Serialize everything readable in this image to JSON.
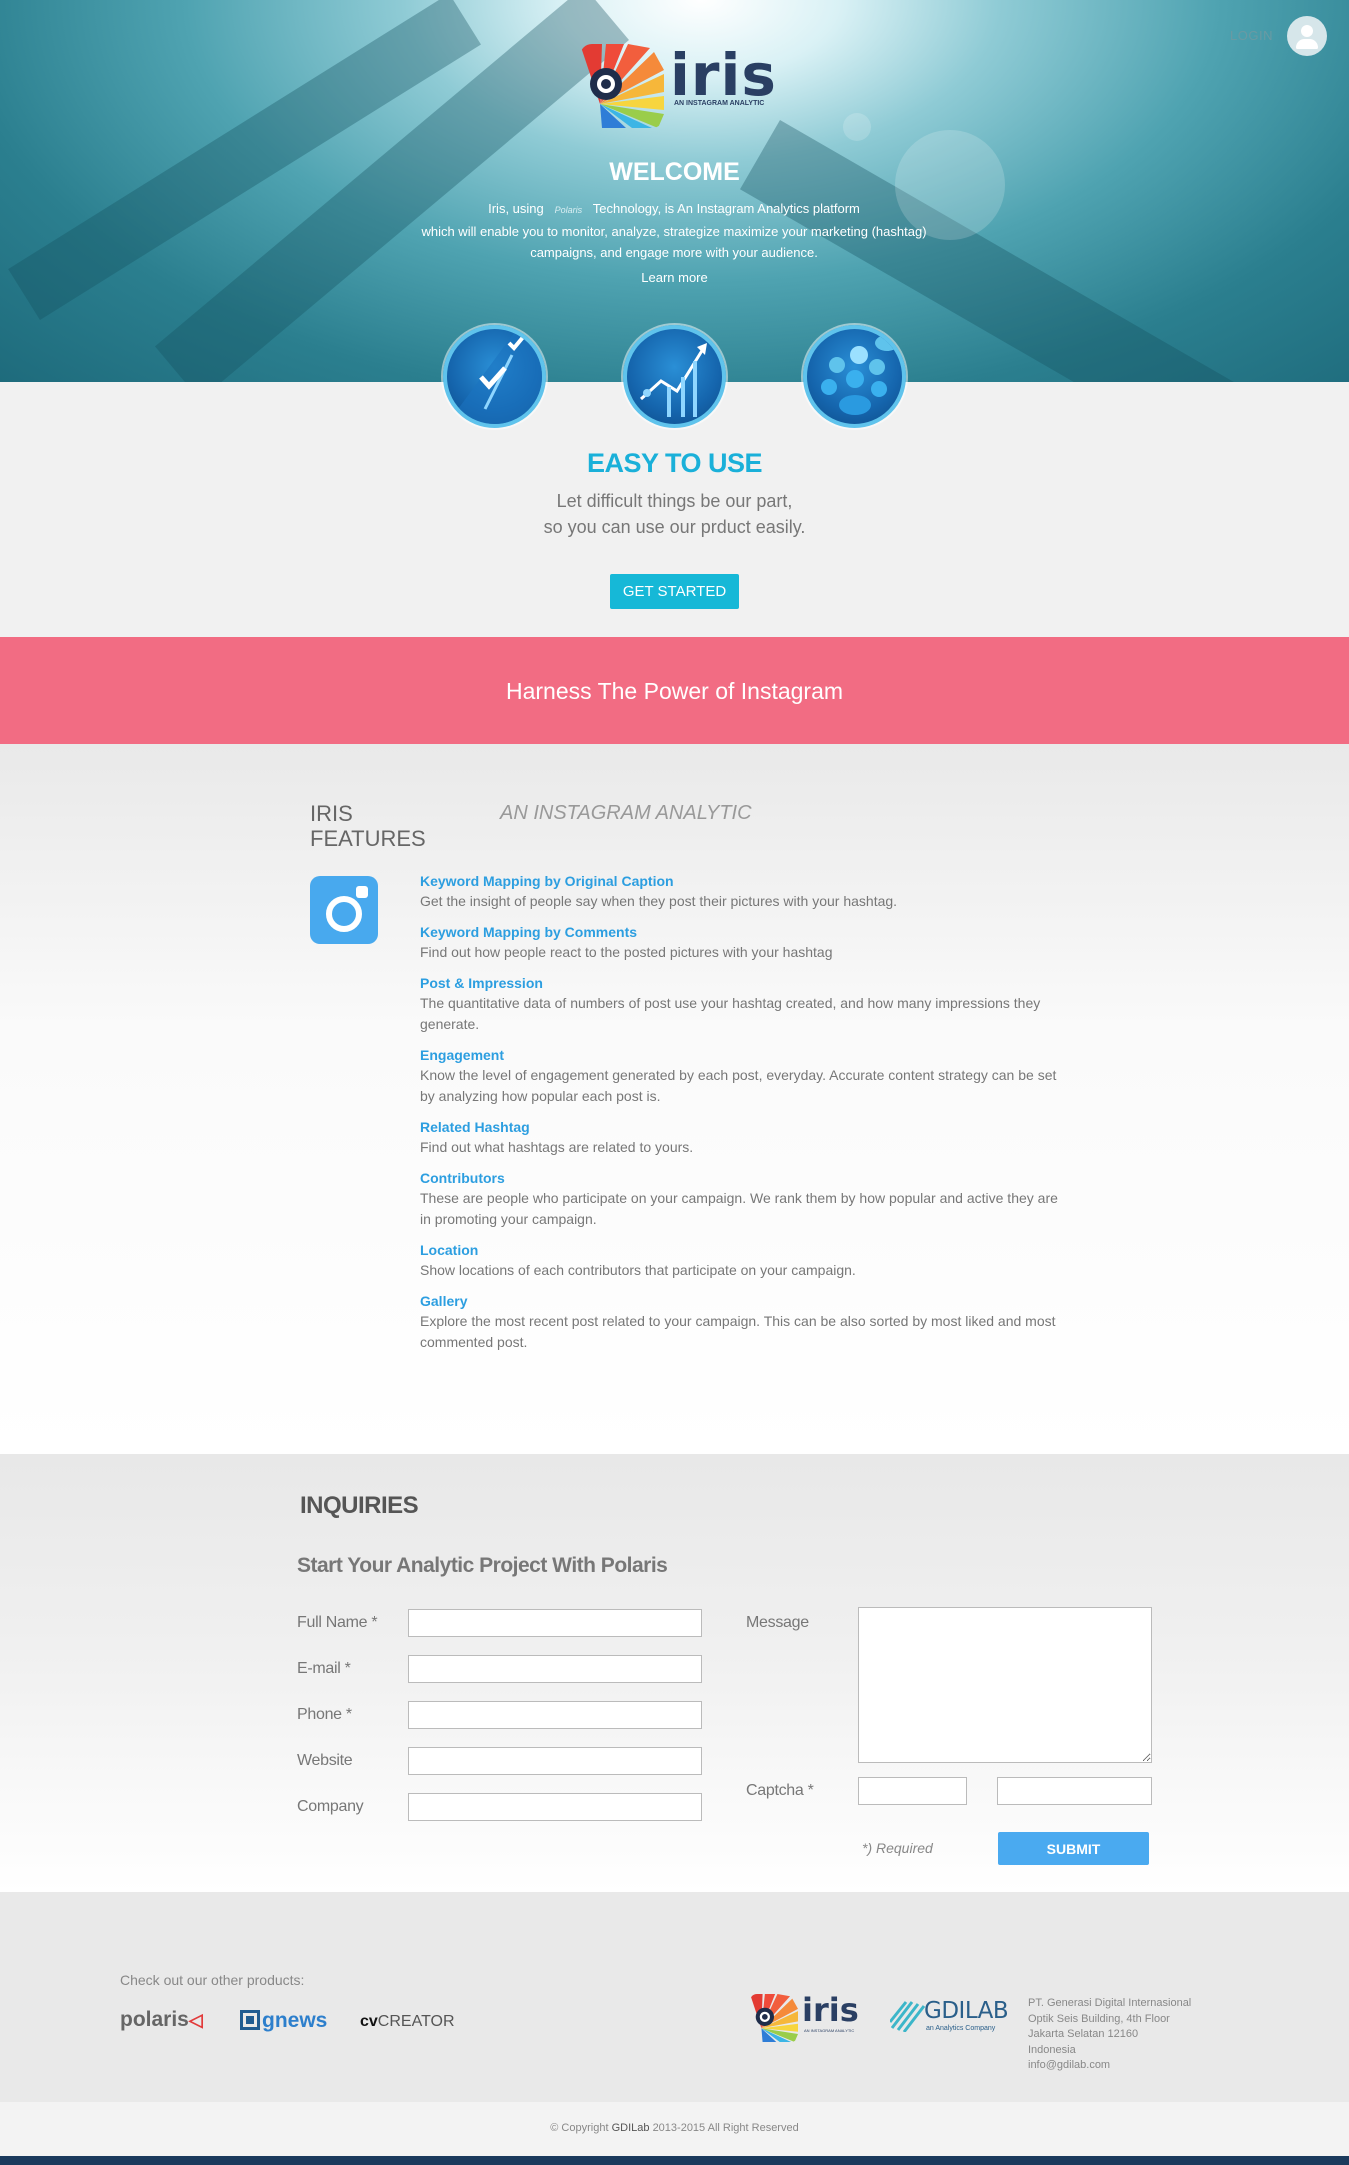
{
  "header": {
    "login_label": "LOGIN",
    "brand_name": "iris",
    "brand_dot": "",
    "brand_tagline": "AN INSTAGRAM ANALYTIC"
  },
  "hero": {
    "welcome": "WELCOME",
    "intro_before": "Iris, using",
    "intro_brand": "Polaris",
    "intro_after": "Technology, is An Instagram Analytics platform",
    "intro_line2": "which will enable you to monitor, analyze, strategize maximize your marketing (hashtag)",
    "intro_line3": "campaigns, and engage more with your audience.",
    "learn_more": "Learn more",
    "icons": [
      "checkmark-icon",
      "growth-chart-icon",
      "community-icon"
    ]
  },
  "easy": {
    "title": "EASY TO USE",
    "line1": "Let difficult things be our part,",
    "line2": "so you can use our prduct easily.",
    "cta": "GET STARTED"
  },
  "banner": {
    "title": "Harness The Power of Instagram"
  },
  "features": {
    "title_line1": "IRIS",
    "title_line2": "FEATURES",
    "tagline": "AN INSTAGRAM ANALYTIC",
    "items": [
      {
        "title": "Keyword Mapping by Original Caption",
        "desc": "Get the insight of people say when they post their pictures with your hashtag."
      },
      {
        "title": "Keyword Mapping by Comments",
        "desc": "Find out how people react to the posted pictures with your hashtag"
      },
      {
        "title": "Post & Impression",
        "desc": "The quantitative data of numbers of post use your hashtag created, and how many impressions they generate."
      },
      {
        "title": "Engagement",
        "desc": "Know the level of engagement generated by each post, everyday. Accurate content strategy can be set by analyzing how popular each post is."
      },
      {
        "title": "Related Hashtag",
        "desc": "Find out what hashtags are related to yours."
      },
      {
        "title": "Contributors",
        "desc": "These are people who participate on your campaign. We rank them by how popular and active they are in promoting your campaign."
      },
      {
        "title": "Location",
        "desc": "Show locations of each contributors that participate on your campaign."
      },
      {
        "title": "Gallery",
        "desc": "Explore the most recent post related to your campaign. This can be also sorted by most liked and most commented post."
      }
    ]
  },
  "inquiries": {
    "title": "INQUIRIES",
    "subtitle": "Start Your Analytic Project With Polaris",
    "full_name_label": "Full Name *",
    "email_label": "E-mail *",
    "phone_label": "Phone *",
    "website_label": "Website",
    "company_label": "Company",
    "message_label": "Message",
    "captcha_label": "Captcha *",
    "required_note": "*) Required",
    "submit_label": "SUBMIT"
  },
  "footer": {
    "other_products": "Check out our other products:",
    "product_polaris": "polaris",
    "product_gnews": "gnews",
    "product_cv_bold": "cv",
    "product_cv_rest": "CREATOR",
    "gdilab_name": "GDILAB",
    "gdilab_tagline": "an Analytics Company",
    "iris_name": "iris",
    "iris_tagline": "AN INSTAGRAM ANALYTIC",
    "address": [
      "PT. Generasi Digital Internasional",
      "Optik Seis Building, 4th Floor",
      "Jakarta Selatan 12160",
      "Indonesia",
      "info@gdilab.com"
    ],
    "copyright_before": "© Copyright",
    "copyright_brand": "GDILab",
    "copyright_after": "2013-2015 All Right Reserved"
  },
  "colors": {
    "accent_cyan": "#16b8d7",
    "banner_pink": "#f26c83",
    "feature_blue": "#2c9ee0",
    "submit_blue": "#4aaaf0"
  }
}
